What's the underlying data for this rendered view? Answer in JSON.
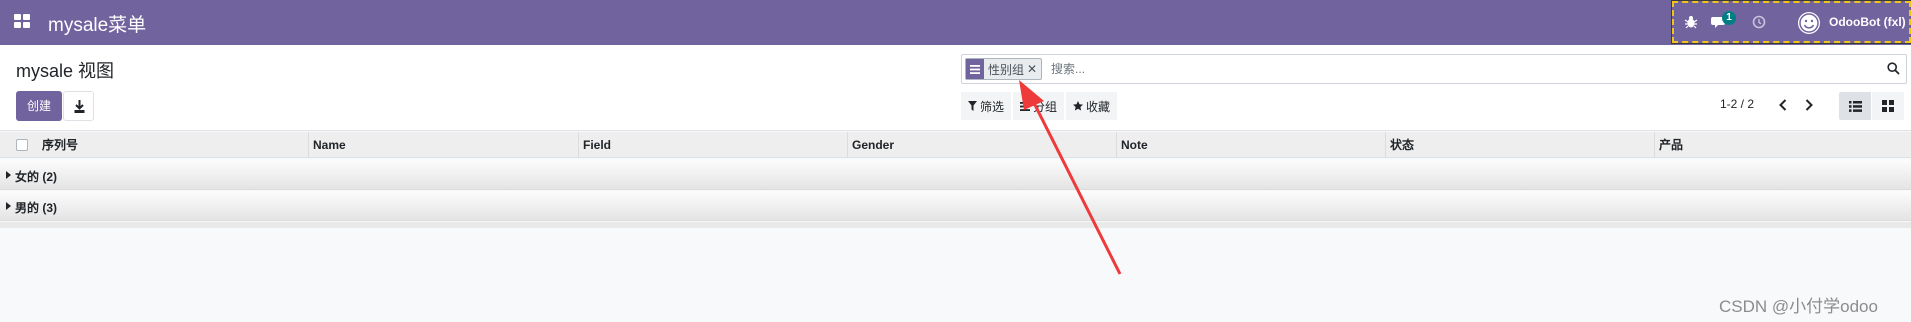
{
  "navbar": {
    "app_title": "mysale菜单",
    "messages_badge": "1",
    "user_name": "OdooBot (fxl)",
    "color": "#71639e"
  },
  "control_panel": {
    "breadcrumb": "mysale 视图",
    "create_label": "创建",
    "search": {
      "facet_label": "性别组",
      "placeholder": "搜索..."
    },
    "filters": {
      "filter_label": "筛选",
      "groupby_label": "分组",
      "favorites_label": "收藏"
    },
    "pager": "1-2 / 2"
  },
  "list": {
    "columns": [
      "序列号",
      "Name",
      "Field",
      "Gender",
      "Note",
      "状态",
      "产品"
    ],
    "groups": [
      {
        "label": "女的 (2)"
      },
      {
        "label": "男的 (3)"
      }
    ]
  },
  "watermark": "CSDN @小付学odoo",
  "icons": [
    "apps-icon",
    "bug-icon",
    "chat-icon",
    "clock-icon",
    "avatar",
    "download-icon",
    "filter-icon",
    "groupby-icon",
    "star-icon",
    "search-icon",
    "chevron-left-icon",
    "chevron-right-icon",
    "list-view-icon",
    "kanban-view-icon",
    "annotation-arrow"
  ]
}
